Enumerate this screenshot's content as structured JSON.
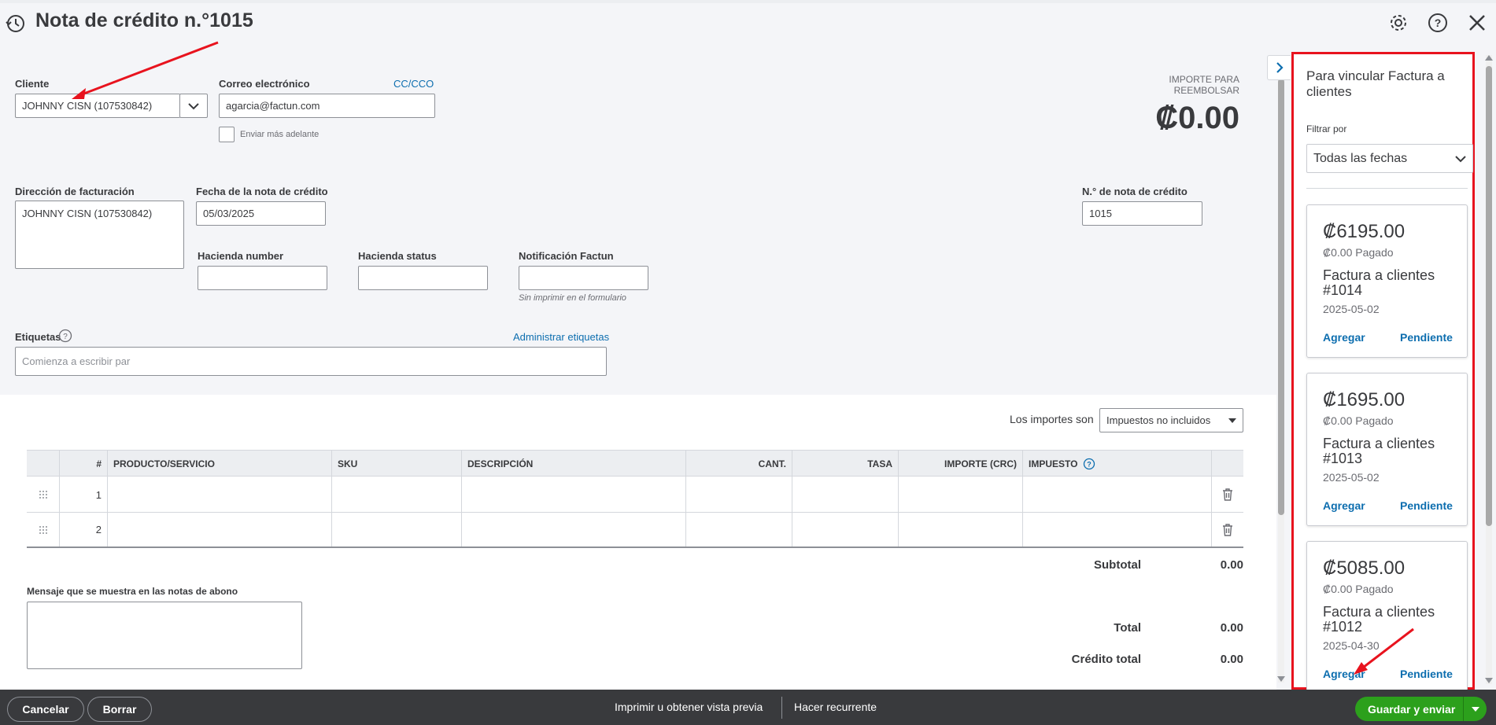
{
  "header": {
    "title": "Nota de crédito n.°1015",
    "icons": [
      "history-icon",
      "gear-icon",
      "help-icon",
      "close-icon"
    ]
  },
  "form": {
    "client_label": "Cliente",
    "client_value": "JOHNNY CISN (107530842)",
    "email_label": "Correo electrónico",
    "cc_link": "CC/CCO",
    "email_value": "agarcia@factun.com",
    "send_later_label": "Enviar más adelante",
    "refund_label_line1": "IMPORTE PARA",
    "refund_label_line2": "REEMBOLSAR",
    "refund_amount": "₡0.00",
    "billing_label": "Dirección de facturación",
    "billing_value": "JOHNNY CISN (107530842)",
    "date_label": "Fecha de la nota de crédito",
    "date_value": "05/03/2025",
    "number_label": "N.° de nota de crédito",
    "number_value": "1015",
    "hacienda_number_label": "Hacienda number",
    "hacienda_status_label": "Hacienda status",
    "notif_label": "Notificación Factun",
    "notif_hint": "Sin imprimir en el formulario",
    "tags_label": "Etiquetas",
    "manage_tags_link": "Administrar etiquetas",
    "tags_placeholder": "Comienza a escribir par"
  },
  "table": {
    "amounts_are_label": "Los importes son",
    "amounts_are_value": "Impuestos no incluidos",
    "columns": [
      "#",
      "PRODUCTO/SERVICIO",
      "SKU",
      "DESCRIPCIÓN",
      "CANT.",
      "TASA",
      "IMPORTE (CRC)",
      "IMPUESTO"
    ],
    "rows": [
      "1",
      "2"
    ]
  },
  "totals": {
    "subtotal_label": "Subtotal",
    "subtotal_value": "0.00",
    "total_label": "Total",
    "total_value": "0.00",
    "credit_label": "Crédito total",
    "credit_value": "0.00"
  },
  "message": {
    "label": "Mensaje que se muestra en las notas de abono"
  },
  "sidebar": {
    "title": "Para vincular Factura a clientes",
    "filter_label": "Filtrar por",
    "filter_value": "Todas las fechas",
    "cards": [
      {
        "amount": "₡6195.00",
        "paid": "₡0.00 Pagado",
        "title": "Factura a clientes #1014",
        "date": "2025-05-02",
        "add": "Agregar",
        "pending": "Pendiente"
      },
      {
        "amount": "₡1695.00",
        "paid": "₡0.00 Pagado",
        "title": "Factura a clientes #1013",
        "date": "2025-05-02",
        "add": "Agregar",
        "pending": "Pendiente"
      },
      {
        "amount": "₡5085.00",
        "paid": "₡0.00 Pagado",
        "title": "Factura a clientes #1012",
        "date": "2025-04-30",
        "add": "Agregar",
        "pending": "Pendiente"
      }
    ]
  },
  "footer": {
    "cancel": "Cancelar",
    "clear": "Borrar",
    "print": "Imprimir u obtener vista previa",
    "recurring": "Hacer recurrente",
    "save_send": "Guardar y enviar"
  },
  "colors": {
    "accent_link": "#0d6eaf",
    "primary_green": "#2ca01c",
    "highlight_red": "#e8131e",
    "footer_bg": "#393a3d"
  }
}
